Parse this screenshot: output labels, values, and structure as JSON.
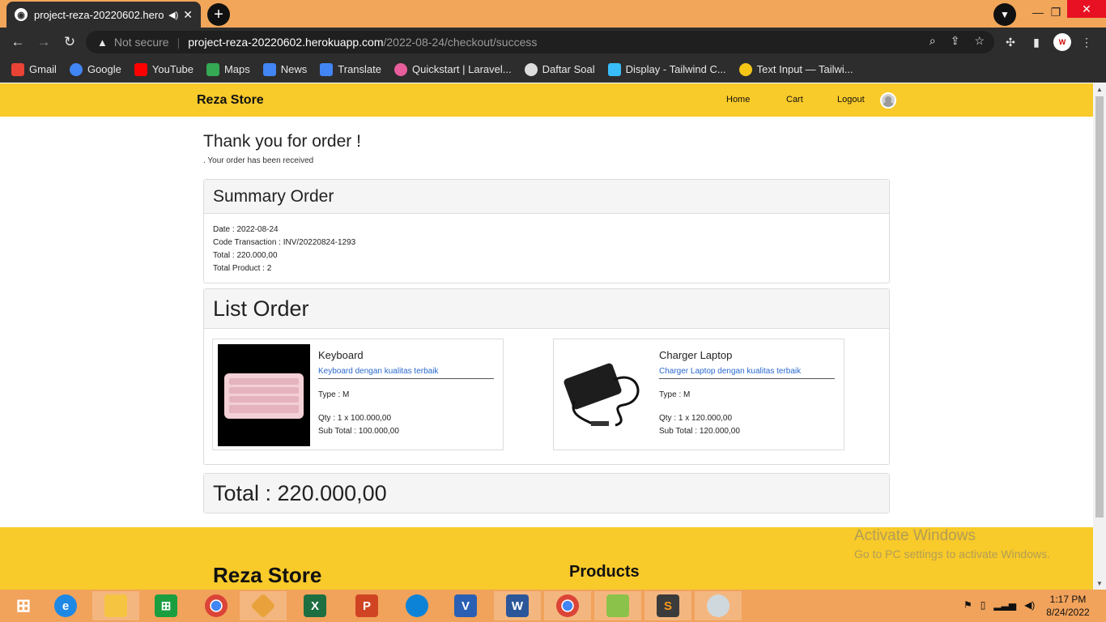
{
  "browser": {
    "tab_title": "project-reza-20220602.herok",
    "tab_audio_icon": "speaker-icon",
    "tab_close": "✕",
    "new_tab": "+",
    "security_label": "Not secure",
    "url_host": "project-reza-20220602.herokuapp.com",
    "url_path": "/2022-08-24/checkout/success",
    "profile_badge": "W",
    "bookmarks": [
      {
        "label": "Gmail",
        "color": "#ea4335"
      },
      {
        "label": "Google",
        "color": "#4285f4"
      },
      {
        "label": "YouTube",
        "color": "#ff0000"
      },
      {
        "label": "Maps",
        "color": "#34a853"
      },
      {
        "label": "News",
        "color": "#4285f4"
      },
      {
        "label": "Translate",
        "color": "#4285f4"
      },
      {
        "label": "Quickstart | Laravel...",
        "color": "#e85d9b"
      },
      {
        "label": "Daftar Soal",
        "color": "#dddddd"
      },
      {
        "label": "Display - Tailwind C...",
        "color": "#38bdf8"
      },
      {
        "label": "Text Input — Tailwi...",
        "color": "#f5c518"
      }
    ]
  },
  "site": {
    "brand": "Reza Store",
    "nav": {
      "home": "Home",
      "cart": "Cart",
      "logout": "Logout"
    },
    "thanks_title": "Thank you for order !",
    "received_text": ". Your order has been received",
    "summary": {
      "heading": "Summary Order",
      "date": "Date : 2022-08-24",
      "code": "Code Transaction : INV/20220824-1293",
      "total": "Total : 220.000,00",
      "total_product": "Total Product : 2"
    },
    "list": {
      "heading": "List Order",
      "items": [
        {
          "name": "Keyboard",
          "desc": "Keyboard dengan kualitas terbaik",
          "type": "Type : M",
          "qty": "Qty : 1 x 100.000,00",
          "subtotal": "Sub Total : 100.000,00"
        },
        {
          "name": "Charger Laptop",
          "desc": "Charger Laptop dengan kualitas terbaik",
          "type": "Type : M",
          "qty": "Qty : 1 x 120.000,00",
          "subtotal": "Sub Total : 120.000,00"
        }
      ]
    },
    "grand_total": "Total : 220.000,00",
    "footer": {
      "brand": "Reza Store",
      "products": "Products"
    }
  },
  "watermark": {
    "line1": "Activate Windows",
    "line2": "Go to PC settings to activate Windows."
  },
  "taskbar": {
    "clock_time": "1:17 PM",
    "clock_date": "8/24/2022"
  }
}
